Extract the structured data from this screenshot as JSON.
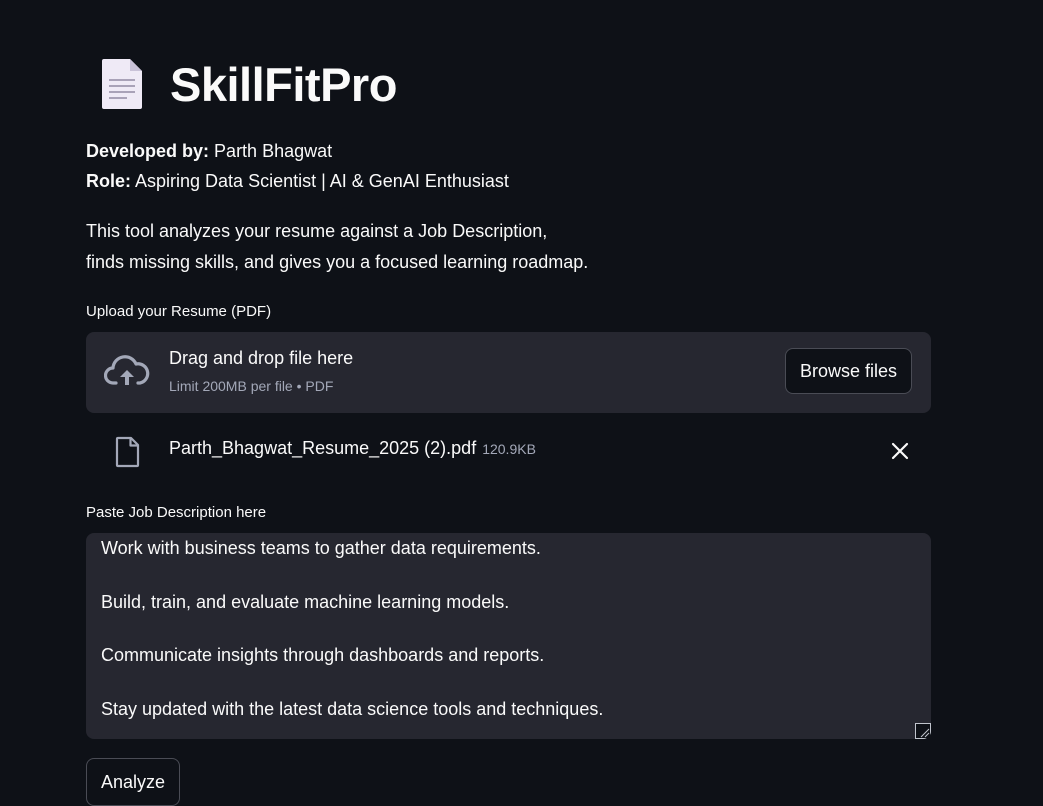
{
  "app": {
    "title": "SkillFitPro",
    "title_icon": "page-facing-up-icon"
  },
  "info": {
    "developed_by_label": "Developed by:",
    "developed_by_value": "Parth Bhagwat",
    "role_label": "Role:",
    "role_value": "Aspiring Data Scientist | AI & GenAI Enthusiast"
  },
  "description": {
    "line1": "This tool analyzes your resume against a Job Description,",
    "line2": "finds missing skills, and gives you a focused learning roadmap."
  },
  "upload": {
    "label": "Upload your Resume (PDF)",
    "drop_text": "Drag and drop file here",
    "limit_text": "Limit 200MB per file • PDF",
    "browse_label": "Browse files",
    "uploaded_file": {
      "name": "Parth_Bhagwat_Resume_2025 (2).pdf",
      "size": "120.9KB"
    }
  },
  "job_description": {
    "label": "Paste Job Description here",
    "visible_lines": [
      "Work with business teams to gather data requirements.",
      "Build, train, and evaluate machine learning models.",
      "Communicate insights through dashboards and reports.",
      "Stay updated with the latest data science tools and techniques."
    ]
  },
  "actions": {
    "analyze_label": "Analyze"
  },
  "colors": {
    "background": "#0e1117",
    "widget_background": "#262730",
    "text": "#fafafa",
    "muted_text": "#a3a8b8",
    "border": "#4a4c55"
  }
}
